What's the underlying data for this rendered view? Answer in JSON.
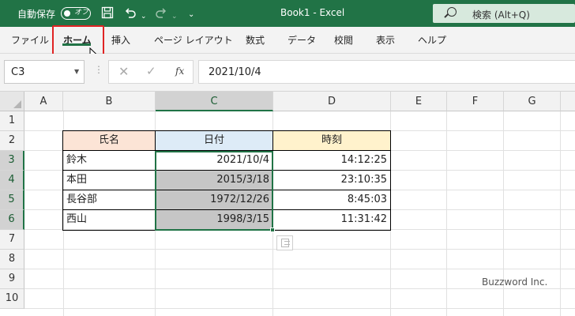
{
  "titlebar": {
    "autosave_label": "自動保存",
    "autosave_state": "オフ",
    "title": "Book1  -  Excel",
    "search_placeholder": "検索 (Alt+Q)",
    "bg_color": "#217346"
  },
  "ribbon": {
    "tabs": [
      {
        "label": "ファイル"
      },
      {
        "label": "ホーム"
      },
      {
        "label": "挿入"
      },
      {
        "label": "ページ レイアウト"
      },
      {
        "label": "数式"
      },
      {
        "label": "データ"
      },
      {
        "label": "校閲"
      },
      {
        "label": "表示"
      },
      {
        "label": "ヘルプ"
      }
    ],
    "active_tab": "ホーム",
    "highlight_color": "#e02424"
  },
  "formula_bar": {
    "name_box": "C3",
    "fx_label": "fx",
    "value": "2021/10/4"
  },
  "grid": {
    "columns": [
      "A",
      "B",
      "C",
      "D",
      "E",
      "F",
      "G"
    ],
    "rows": [
      "1",
      "2",
      "3",
      "4",
      "5",
      "6",
      "7",
      "8",
      "9",
      "10"
    ],
    "selected_column": "C",
    "selected_rows": [
      "3",
      "4",
      "5",
      "6"
    ]
  },
  "table": {
    "headers": {
      "name": "氏名",
      "date": "日付",
      "time": "時刻"
    },
    "header_colors": {
      "name": "#fce4d6",
      "date": "#ddebf7",
      "time": "#fff2cc"
    },
    "rows": [
      {
        "name": "鈴木",
        "date": "2021/10/4",
        "time": "14:12:25"
      },
      {
        "name": "本田",
        "date": "2015/3/18",
        "time": "23:10:35"
      },
      {
        "name": "長谷部",
        "date": "1972/12/26",
        "time": "8:45:03"
      },
      {
        "name": "西山",
        "date": "1998/3/15",
        "time": "11:31:42"
      }
    ]
  },
  "watermark": "Buzzword Inc."
}
